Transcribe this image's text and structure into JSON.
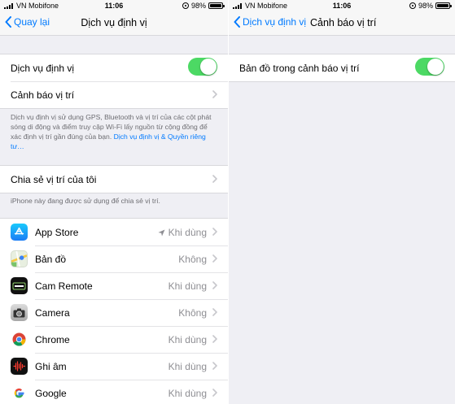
{
  "status": {
    "carrier": "VN Mobifone",
    "time": "11:06",
    "battery": "98%",
    "battery_level": 0.98
  },
  "left": {
    "back_label": "Quay lại",
    "title": "Dịch vụ định vị",
    "location_services": {
      "label": "Dịch vụ định vị",
      "on": true
    },
    "location_alerts_label": "Cảnh báo vị trí",
    "info_text": "Dịch vụ định vị sử dụng GPS, Bluetooth và vị trí của các cột phát sóng di động và điểm truy cập Wi-Fi lấy nguồn từ cộng đồng để xác định vị trí gần đúng của bạn.",
    "info_link": "Dịch vụ định vị & Quyền riêng tư…",
    "share_location_label": "Chia sẻ vị trí của tôi",
    "share_note": "iPhone này đang được sử dụng để chia sẻ vị trí.",
    "apps": [
      {
        "name": "App Store",
        "value": "Khi dùng",
        "icon": "app-store-icon",
        "recent_location": true
      },
      {
        "name": "Bản đồ",
        "value": "Không",
        "icon": "maps-icon"
      },
      {
        "name": "Cam Remote",
        "value": "Khi dùng",
        "icon": "cam-remote-icon"
      },
      {
        "name": "Camera",
        "value": "Không",
        "icon": "camera-icon"
      },
      {
        "name": "Chrome",
        "value": "Khi dùng",
        "icon": "chrome-icon"
      },
      {
        "name": "Ghi âm",
        "value": "Khi dùng",
        "icon": "voice-memos-icon"
      },
      {
        "name": "Google",
        "value": "Khi dùng",
        "icon": "google-icon"
      }
    ]
  },
  "right": {
    "back_label": "Dịch vụ định vị",
    "title": "Cảnh báo vị trí",
    "maps_alert": {
      "label": "Bản đồ trong cảnh báo vị trí",
      "on": true
    }
  },
  "colors": {
    "accent": "#007aff",
    "toggle_on": "#4cd964",
    "background": "#efeff4",
    "secondary_text": "#8e8e93"
  }
}
